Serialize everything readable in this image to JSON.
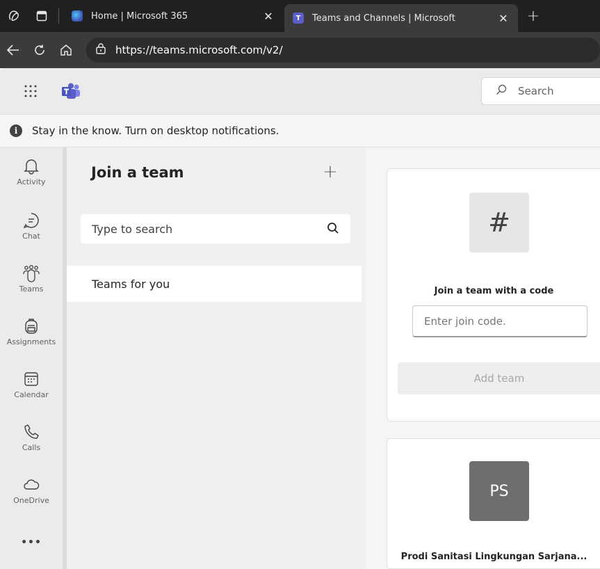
{
  "browser": {
    "tabs": [
      {
        "title": "Home | Microsoft 365",
        "active": false
      },
      {
        "title": "Teams and Channels | Microsoft",
        "active": true
      }
    ],
    "url": "https://teams.microsoft.com/v2/"
  },
  "header": {
    "search_placeholder": "Search"
  },
  "notification": {
    "text": "Stay in the know. Turn on desktop notifications."
  },
  "rail": {
    "items": [
      {
        "label": "Activity",
        "icon": "bell-icon"
      },
      {
        "label": "Chat",
        "icon": "chat-icon"
      },
      {
        "label": "Teams",
        "icon": "teams-icon"
      },
      {
        "label": "Assignments",
        "icon": "backpack-icon"
      },
      {
        "label": "Calendar",
        "icon": "calendar-icon"
      },
      {
        "label": "Calls",
        "icon": "phone-icon"
      },
      {
        "label": "OneDrive",
        "icon": "cloud-icon"
      }
    ],
    "more": "•••"
  },
  "join_pane": {
    "title": "Join a team",
    "search_placeholder": "Type to search",
    "list": [
      {
        "label": "Teams for you"
      }
    ]
  },
  "join_code_card": {
    "label": "Join a team with a code",
    "input_placeholder": "Enter join code.",
    "button_label": "Add team",
    "tile_symbol": "#"
  },
  "team_card": {
    "initials": "PS",
    "name": "Prodi Sanitasi Lingkungan Sarjana..."
  },
  "colors": {
    "browser_bg": "#202020",
    "teams_purple": "#5b5fc7",
    "edge_blue": "#2b7cd3"
  }
}
